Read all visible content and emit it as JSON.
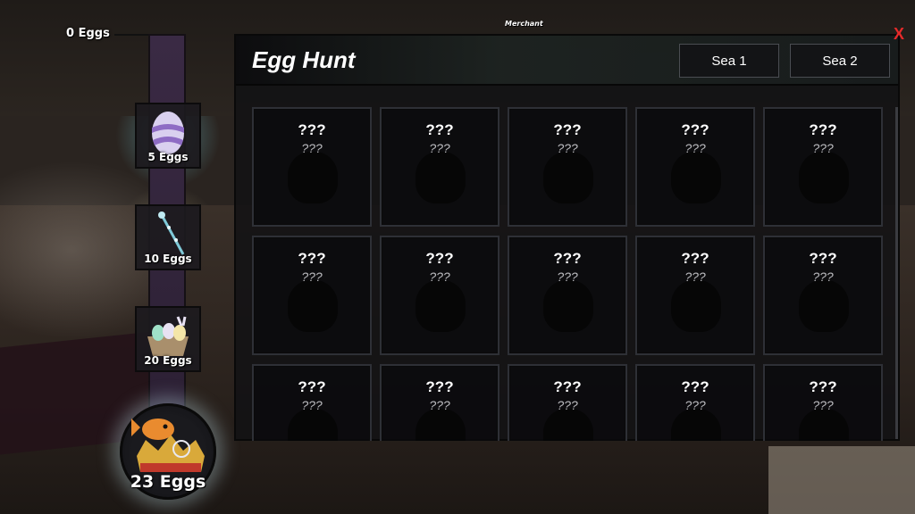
{
  "progress": {
    "current_label": "0 Eggs",
    "rewards": [
      {
        "label": "5 Eggs",
        "icon": "striped-egg-icon",
        "glow": "#7ad7e6"
      },
      {
        "label": "10 Eggs",
        "icon": "wand-icon",
        "glow": "#c8c190"
      },
      {
        "label": "20 Eggs",
        "icon": "egg-basket-icon",
        "glow": "#d2b8e6"
      }
    ],
    "final_reward": {
      "label": "23 Eggs",
      "icon": "fish-crown-icon"
    }
  },
  "npc_tag": "Merchant",
  "panel": {
    "title": "Egg Hunt",
    "tabs": [
      "Sea 1",
      "Sea 2"
    ],
    "close_label": "X",
    "items": [
      {
        "title": "???",
        "subtitle": "???"
      },
      {
        "title": "???",
        "subtitle": "???"
      },
      {
        "title": "???",
        "subtitle": "???"
      },
      {
        "title": "???",
        "subtitle": "???"
      },
      {
        "title": "???",
        "subtitle": "???"
      },
      {
        "title": "???",
        "subtitle": "???"
      },
      {
        "title": "???",
        "subtitle": "???"
      },
      {
        "title": "???",
        "subtitle": "???"
      },
      {
        "title": "???",
        "subtitle": "???"
      },
      {
        "title": "???",
        "subtitle": "???"
      },
      {
        "title": "???",
        "subtitle": "???"
      },
      {
        "title": "???",
        "subtitle": "???"
      },
      {
        "title": "???",
        "subtitle": "???"
      },
      {
        "title": "???",
        "subtitle": "???"
      },
      {
        "title": "???",
        "subtitle": "???"
      }
    ]
  },
  "colors": {
    "close": "#e62a2a",
    "track": "#3a2a44"
  }
}
